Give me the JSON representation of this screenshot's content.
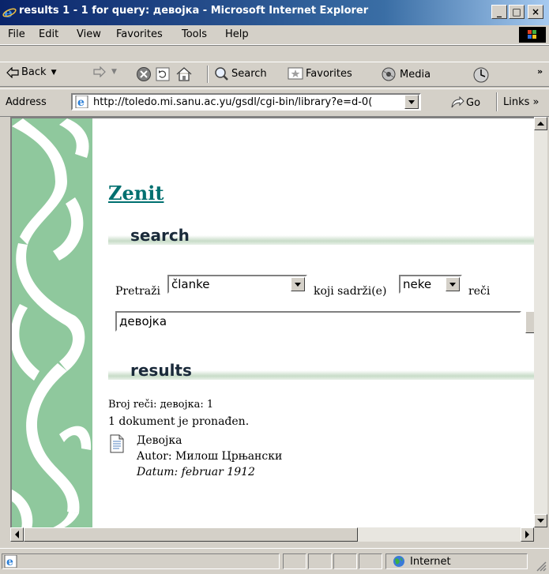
{
  "window": {
    "title": "results 1 - 1 for query: девојка - Microsoft Internet Explorer",
    "buttons": {
      "minimize": "_",
      "maximize": "□",
      "close": "×"
    }
  },
  "menu": {
    "file": "File",
    "edit": "Edit",
    "view": "View",
    "favorites": "Favorites",
    "tools": "Tools",
    "help": "Help"
  },
  "toolbar": {
    "back": "Back",
    "search": "Search",
    "favorites": "Favorites",
    "media": "Media"
  },
  "address": {
    "label": "Address",
    "url": "http://toledo.mi.sanu.ac.yu/gsdl/cgi-bin/library?e=d-0(",
    "go": "Go",
    "links": "Links »"
  },
  "page": {
    "title": "Zenit",
    "search_heading": "search",
    "results_heading": "results",
    "search_prefix": "Pretraži",
    "search_middle": "koji sadrži(e)",
    "search_suffix": "reči",
    "select_type": "članke",
    "select_mode": "neke",
    "query": "девојка",
    "word_count": "Broj reči: девојка: 1",
    "found": "1 dokument je pronađen.",
    "result": {
      "title": "Девојка",
      "author": "Autor: Милош Црњански",
      "date": "Datum: februar 1912"
    }
  },
  "status": {
    "zone": "Internet"
  },
  "colors": {
    "sidebar": "#8fc89d",
    "link": "#007070",
    "titlebar": "#0a246a"
  }
}
